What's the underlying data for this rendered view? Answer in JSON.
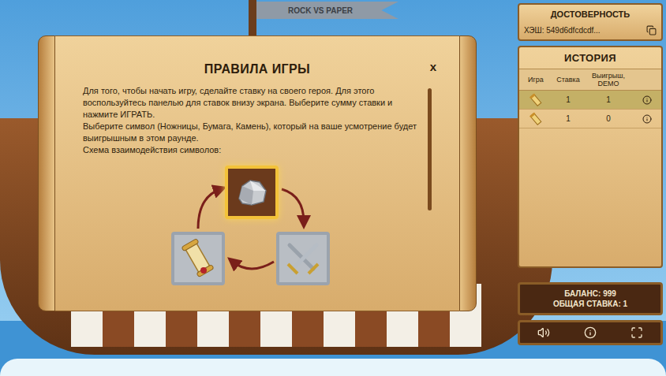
{
  "flag": "ROCK VS PAPER",
  "rules": {
    "title": "ПРАВИЛА ИГРЫ",
    "close": "x",
    "paragraphs": [
      "Для того, чтобы начать игру, сделайте ставку на своего героя. Для этого воспользуйтесь панелью для ставок внизу экрана. Выберите сумму ставки и нажмите ИГРАТЬ.",
      "Выберите символ (Ножницы, Бумага, Камень), который на ваше усмотрение будет выигрышным в этом раунде.",
      "Схема взаимодействия символов:"
    ],
    "symbols": [
      {
        "kind": "rock",
        "selected": true
      },
      {
        "kind": "scissors",
        "selected": false
      },
      {
        "kind": "paper",
        "selected": false
      }
    ]
  },
  "fairness": {
    "title": "ДОСТОВЕРНОСТЬ",
    "hash": "ХЭШ: 549d6dfcdcdf..."
  },
  "history": {
    "title": "ИСТОРИЯ",
    "columns": [
      "Игра",
      "Ставка",
      "Выигрыш, DEMO"
    ],
    "rows": [
      {
        "bet": "1",
        "win": "1",
        "selected": true
      },
      {
        "bet": "1",
        "win": "0",
        "selected": false
      }
    ]
  },
  "balance": {
    "balance": "БАЛАНС: 999",
    "total_bet": "ОБЩАЯ СТАВКА: 1"
  }
}
